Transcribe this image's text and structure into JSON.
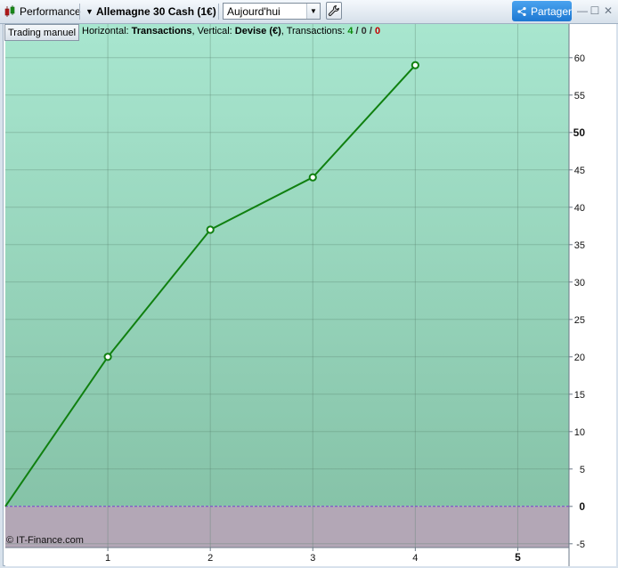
{
  "toolbar": {
    "app_label": "Performance",
    "instrument_label": "Allemagne 30 Cash (1€)",
    "period_value": "Aujourd'hui",
    "share_label": "Partager",
    "window_controls": [
      "—",
      "☐",
      "✕"
    ]
  },
  "chart_header": {
    "trading_button": "Trading manuel",
    "horizontal_prefix": "Horizontal: ",
    "horizontal_value": "Transactions",
    "vertical_prefix": ", Vertical: ",
    "vertical_value": "Devise (€)",
    "transactions_prefix": ", Transactions: ",
    "tx_win": "4",
    "tx_sep1": " / ",
    "tx_neutral": "0",
    "tx_sep2": " / ",
    "tx_loss": "0"
  },
  "copyright": "© IT-Finance.com",
  "colors": {
    "gain_zone_top": "#a8e6cf",
    "gain_zone_bottom": "#86c3a8",
    "loss_zone": "#b3a7b6",
    "line": "#108010",
    "zero_line": "#7a3fd0"
  },
  "chart_data": {
    "type": "line",
    "x": [
      0,
      1,
      2,
      3,
      4
    ],
    "y": [
      0,
      20,
      37,
      44,
      59
    ],
    "xlim": [
      0,
      5.5
    ],
    "ylim": [
      -5.5,
      64.5
    ],
    "xticks": [
      1,
      2,
      3,
      4,
      5
    ],
    "yticks": [
      -5,
      0,
      5,
      10,
      15,
      20,
      25,
      30,
      35,
      40,
      45,
      50,
      55,
      60
    ],
    "bold_xticks": [
      5
    ],
    "bold_yticks": [
      0,
      50
    ],
    "grid": true
  }
}
